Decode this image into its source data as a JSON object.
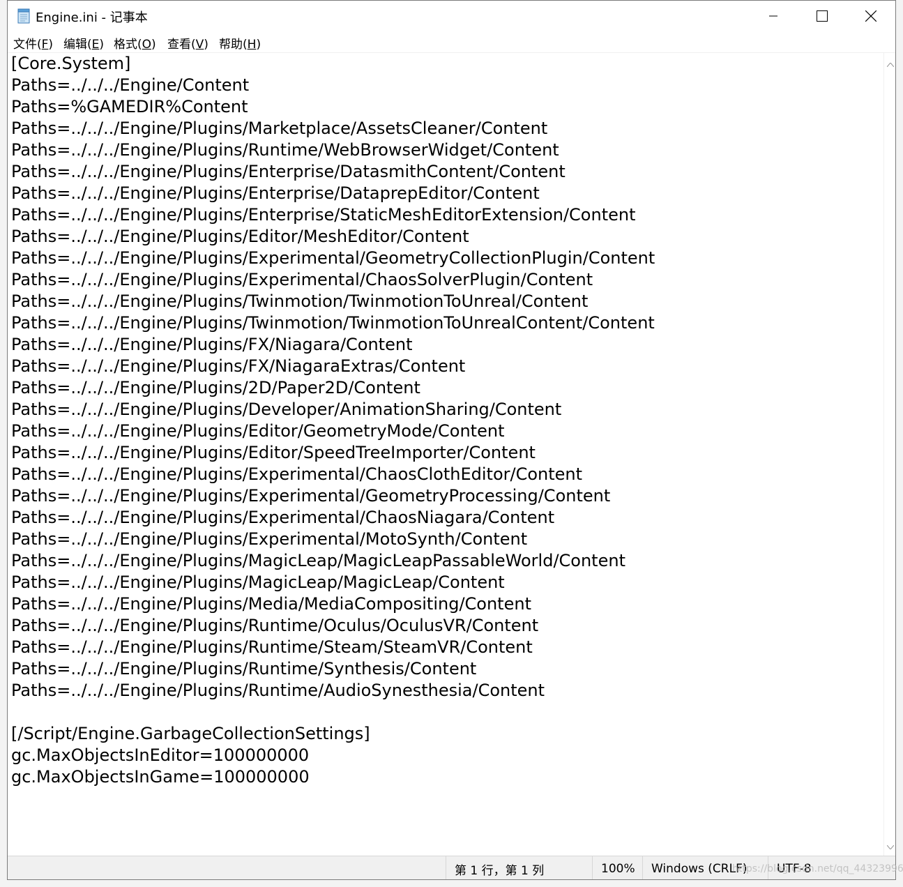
{
  "window": {
    "title": "Engine.ini - 记事本"
  },
  "menu": {
    "items": [
      {
        "prefix": "文件(",
        "key": "F",
        "suffix": ")"
      },
      {
        "prefix": "编辑(",
        "key": "E",
        "suffix": ")"
      },
      {
        "prefix": "格式(",
        "key": "O",
        "suffix": ")"
      },
      {
        "prefix": "查看(",
        "key": "V",
        "suffix": ")"
      },
      {
        "prefix": "帮助(",
        "key": "H",
        "suffix": ")"
      }
    ]
  },
  "editor": {
    "lines": [
      "[Core.System]",
      "Paths=../../../Engine/Content",
      "Paths=%GAMEDIR%Content",
      "Paths=../../../Engine/Plugins/Marketplace/AssetsCleaner/Content",
      "Paths=../../../Engine/Plugins/Runtime/WebBrowserWidget/Content",
      "Paths=../../../Engine/Plugins/Enterprise/DatasmithContent/Content",
      "Paths=../../../Engine/Plugins/Enterprise/DataprepEditor/Content",
      "Paths=../../../Engine/Plugins/Enterprise/StaticMeshEditorExtension/Content",
      "Paths=../../../Engine/Plugins/Editor/MeshEditor/Content",
      "Paths=../../../Engine/Plugins/Experimental/GeometryCollectionPlugin/Content",
      "Paths=../../../Engine/Plugins/Experimental/ChaosSolverPlugin/Content",
      "Paths=../../../Engine/Plugins/Twinmotion/TwinmotionToUnreal/Content",
      "Paths=../../../Engine/Plugins/Twinmotion/TwinmotionToUnrealContent/Content",
      "Paths=../../../Engine/Plugins/FX/Niagara/Content",
      "Paths=../../../Engine/Plugins/FX/NiagaraExtras/Content",
      "Paths=../../../Engine/Plugins/2D/Paper2D/Content",
      "Paths=../../../Engine/Plugins/Developer/AnimationSharing/Content",
      "Paths=../../../Engine/Plugins/Editor/GeometryMode/Content",
      "Paths=../../../Engine/Plugins/Editor/SpeedTreeImporter/Content",
      "Paths=../../../Engine/Plugins/Experimental/ChaosClothEditor/Content",
      "Paths=../../../Engine/Plugins/Experimental/GeometryProcessing/Content",
      "Paths=../../../Engine/Plugins/Experimental/ChaosNiagara/Content",
      "Paths=../../../Engine/Plugins/Experimental/MotoSynth/Content",
      "Paths=../../../Engine/Plugins/MagicLeap/MagicLeapPassableWorld/Content",
      "Paths=../../../Engine/Plugins/MagicLeap/MagicLeap/Content",
      "Paths=../../../Engine/Plugins/Media/MediaCompositing/Content",
      "Paths=../../../Engine/Plugins/Runtime/Oculus/OculusVR/Content",
      "Paths=../../../Engine/Plugins/Runtime/Steam/SteamVR/Content",
      "Paths=../../../Engine/Plugins/Runtime/Synthesis/Content",
      "Paths=../../../Engine/Plugins/Runtime/AudioSynesthesia/Content",
      "",
      "[/Script/Engine.GarbageCollectionSettings]",
      "gc.MaxObjectsInEditor=100000000",
      "gc.MaxObjectsInGame=100000000"
    ]
  },
  "status": {
    "position": "第 1 行，第 1 列",
    "zoom": "100%",
    "line_ending": "Windows (CRLF)",
    "encoding": "UTF-8"
  },
  "watermark": "https://blog.csdn.net/qq_44323996",
  "icons": {
    "app": "notepad-icon",
    "minimize": "minimize-icon",
    "maximize": "maximize-icon",
    "close": "close-icon"
  }
}
